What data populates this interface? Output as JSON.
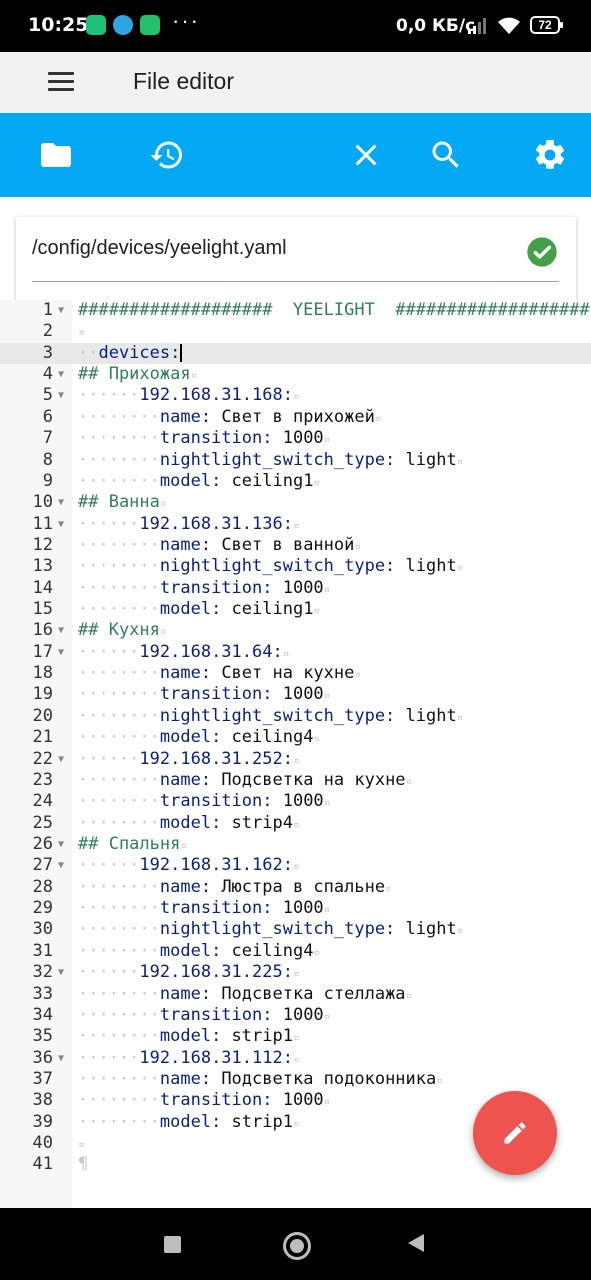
{
  "status_bar": {
    "time": "10:25",
    "more": "···",
    "network_speed": "0,0 КБ/с",
    "battery": "72"
  },
  "app_bar": {
    "title": "File editor"
  },
  "toolbar": {
    "icons": [
      "folder-icon",
      "history-icon",
      "close-icon",
      "search-icon",
      "settings-icon"
    ],
    "color": "#03a9f4"
  },
  "file": {
    "path": "/config/devices/yeelight.yaml",
    "status_color": "#43a047"
  },
  "editor": {
    "lines": [
      {
        "n": "1",
        "fold": true,
        "indent": "",
        "type": "comment",
        "text": "###################  YEELIGHT  ###################"
      },
      {
        "n": "2",
        "fold": false,
        "indent": "",
        "type": "blank",
        "text": ""
      },
      {
        "n": "3",
        "fold": false,
        "indent": "··",
        "type": "kv",
        "key": "devices:",
        "value": "",
        "active": true
      },
      {
        "n": "4",
        "fold": true,
        "indent": "",
        "type": "comment",
        "text": "## Прихожая"
      },
      {
        "n": "5",
        "fold": true,
        "indent": "······",
        "type": "kv",
        "key": "192.168.31.168:",
        "value": ""
      },
      {
        "n": "6",
        "fold": false,
        "indent": "········",
        "type": "kv",
        "key": "name:",
        "value": " Свет в прихожей"
      },
      {
        "n": "7",
        "fold": false,
        "indent": "········",
        "type": "kv",
        "key": "transition:",
        "value": " 1000"
      },
      {
        "n": "8",
        "fold": false,
        "indent": "········",
        "type": "kv",
        "key": "nightlight_switch_type:",
        "value": " light"
      },
      {
        "n": "9",
        "fold": false,
        "indent": "········",
        "type": "kv",
        "key": "model:",
        "value": " ceiling1"
      },
      {
        "n": "10",
        "fold": true,
        "indent": "",
        "type": "comment",
        "text": "## Ванна"
      },
      {
        "n": "11",
        "fold": true,
        "indent": "······",
        "type": "kv",
        "key": "192.168.31.136:",
        "value": ""
      },
      {
        "n": "12",
        "fold": false,
        "indent": "········",
        "type": "kv",
        "key": "name:",
        "value": " Свет в ванной"
      },
      {
        "n": "13",
        "fold": false,
        "indent": "········",
        "type": "kv",
        "key": "nightlight_switch_type:",
        "value": " light"
      },
      {
        "n": "14",
        "fold": false,
        "indent": "········",
        "type": "kv",
        "key": "transition:",
        "value": " 1000"
      },
      {
        "n": "15",
        "fold": false,
        "indent": "········",
        "type": "kv",
        "key": "model:",
        "value": " ceiling1"
      },
      {
        "n": "16",
        "fold": true,
        "indent": "",
        "type": "comment",
        "text": "## Кухня"
      },
      {
        "n": "17",
        "fold": true,
        "indent": "······",
        "type": "kv",
        "key": "192.168.31.64:",
        "value": ""
      },
      {
        "n": "18",
        "fold": false,
        "indent": "········",
        "type": "kv",
        "key": "name:",
        "value": " Свет на кухне"
      },
      {
        "n": "19",
        "fold": false,
        "indent": "········",
        "type": "kv",
        "key": "transition:",
        "value": " 1000"
      },
      {
        "n": "20",
        "fold": false,
        "indent": "········",
        "type": "kv",
        "key": "nightlight_switch_type:",
        "value": " light"
      },
      {
        "n": "21",
        "fold": false,
        "indent": "········",
        "type": "kv",
        "key": "model:",
        "value": " ceiling4"
      },
      {
        "n": "22",
        "fold": true,
        "indent": "······",
        "type": "kv",
        "key": "192.168.31.252:",
        "value": ""
      },
      {
        "n": "23",
        "fold": false,
        "indent": "········",
        "type": "kv",
        "key": "name:",
        "value": " Подсветка на кухне"
      },
      {
        "n": "24",
        "fold": false,
        "indent": "········",
        "type": "kv",
        "key": "transition:",
        "value": " 1000"
      },
      {
        "n": "25",
        "fold": false,
        "indent": "········",
        "type": "kv",
        "key": "model:",
        "value": " strip4"
      },
      {
        "n": "26",
        "fold": true,
        "indent": "",
        "type": "comment",
        "text": "## Спальня"
      },
      {
        "n": "27",
        "fold": true,
        "indent": "······",
        "type": "kv",
        "key": "192.168.31.162:",
        "value": ""
      },
      {
        "n": "28",
        "fold": false,
        "indent": "········",
        "type": "kv",
        "key": "name:",
        "value": " Люстра в спальне"
      },
      {
        "n": "29",
        "fold": false,
        "indent": "········",
        "type": "kv",
        "key": "transition:",
        "value": " 1000"
      },
      {
        "n": "30",
        "fold": false,
        "indent": "········",
        "type": "kv",
        "key": "nightlight_switch_type:",
        "value": " light"
      },
      {
        "n": "31",
        "fold": false,
        "indent": "········",
        "type": "kv",
        "key": "model:",
        "value": " ceiling4"
      },
      {
        "n": "32",
        "fold": true,
        "indent": "······",
        "type": "kv",
        "key": "192.168.31.225:",
        "value": ""
      },
      {
        "n": "33",
        "fold": false,
        "indent": "········",
        "type": "kv",
        "key": "name:",
        "value": " Подсветка стеллажа"
      },
      {
        "n": "34",
        "fold": false,
        "indent": "········",
        "type": "kv",
        "key": "transition:",
        "value": " 1000"
      },
      {
        "n": "35",
        "fold": false,
        "indent": "········",
        "type": "kv",
        "key": "model:",
        "value": " strip1"
      },
      {
        "n": "36",
        "fold": true,
        "indent": "······",
        "type": "kv",
        "key": "192.168.31.112:",
        "value": ""
      },
      {
        "n": "37",
        "fold": false,
        "indent": "········",
        "type": "kv",
        "key": "name:",
        "value": " Подсветка подоконника"
      },
      {
        "n": "38",
        "fold": false,
        "indent": "········",
        "type": "kv",
        "key": "transition:",
        "value": " 1000"
      },
      {
        "n": "39",
        "fold": false,
        "indent": "········",
        "type": "kv",
        "key": "model:",
        "value": " strip1"
      },
      {
        "n": "40",
        "fold": false,
        "indent": "",
        "type": "blank",
        "text": ""
      },
      {
        "n": "41",
        "fold": false,
        "indent": "",
        "type": "eof",
        "text": "¶"
      }
    ]
  },
  "fab": {
    "icon": "pencil-icon",
    "color": "#ef5350"
  },
  "nav_bar": {
    "icons": [
      "recents-icon",
      "home-icon",
      "back-icon"
    ]
  }
}
